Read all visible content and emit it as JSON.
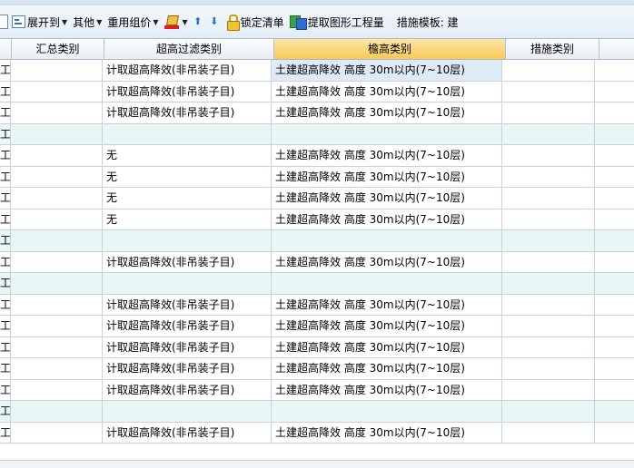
{
  "toolbar": {
    "partial_left_icon": "table-grid-icon",
    "expand_label": "展开到",
    "other_label": "其他",
    "reuse_label": "重用组价",
    "fill_color_icon": "fill-color-icon",
    "move_up_icon": "arrow-up-icon",
    "move_down_icon": "arrow-down-icon",
    "lock_label": "锁定清单",
    "extract_label": "提取图形工程量",
    "measure_template_label": "措施模板: 建"
  },
  "grid": {
    "columns": [
      "",
      "汇总类别",
      "超高过滤类别",
      "檐高类别",
      "措施类别",
      ""
    ],
    "selected_column": "檐高类别",
    "rows": [
      {
        "lead": "工",
        "summary": "",
        "filter": "计取超高降效(非吊装子目)",
        "height": "土建超高降效 高度 30m以内(7~10层)",
        "measure": "",
        "group": false,
        "highlight": true
      },
      {
        "lead": "工",
        "summary": "",
        "filter": "计取超高降效(非吊装子目)",
        "height": "土建超高降效 高度 30m以内(7~10层)",
        "measure": "",
        "group": false,
        "highlight": false
      },
      {
        "lead": "工",
        "summary": "",
        "filter": "计取超高降效(非吊装子目)",
        "height": "土建超高降效 高度 30m以内(7~10层)",
        "measure": "",
        "group": false,
        "highlight": false
      },
      {
        "lead": "工",
        "summary": "",
        "filter": "",
        "height": "",
        "measure": "",
        "group": true,
        "highlight": false
      },
      {
        "lead": "工",
        "summary": "",
        "filter": "无",
        "height": "土建超高降效 高度 30m以内(7~10层)",
        "measure": "",
        "group": false,
        "highlight": false
      },
      {
        "lead": "工",
        "summary": "",
        "filter": "无",
        "height": "土建超高降效 高度 30m以内(7~10层)",
        "measure": "",
        "group": false,
        "highlight": false
      },
      {
        "lead": "工",
        "summary": "",
        "filter": "无",
        "height": "土建超高降效 高度 30m以内(7~10层)",
        "measure": "",
        "group": false,
        "highlight": false
      },
      {
        "lead": "工",
        "summary": "",
        "filter": "无",
        "height": "土建超高降效 高度 30m以内(7~10层)",
        "measure": "",
        "group": false,
        "highlight": false
      },
      {
        "lead": "工",
        "summary": "",
        "filter": "",
        "height": "",
        "measure": "",
        "group": true,
        "highlight": false
      },
      {
        "lead": "工",
        "summary": "",
        "filter": "计取超高降效(非吊装子目)",
        "height": "土建超高降效 高度 30m以内(7~10层)",
        "measure": "",
        "group": false,
        "highlight": false
      },
      {
        "lead": "工",
        "summary": "",
        "filter": "",
        "height": "",
        "measure": "",
        "group": true,
        "highlight": false
      },
      {
        "lead": "工",
        "summary": "",
        "filter": "计取超高降效(非吊装子目)",
        "height": "土建超高降效 高度 30m以内(7~10层)",
        "measure": "",
        "group": false,
        "highlight": false
      },
      {
        "lead": "工",
        "summary": "",
        "filter": "计取超高降效(非吊装子目)",
        "height": "土建超高降效 高度 30m以内(7~10层)",
        "measure": "",
        "group": false,
        "highlight": false
      },
      {
        "lead": "工",
        "summary": "",
        "filter": "计取超高降效(非吊装子目)",
        "height": "土建超高降效 高度 30m以内(7~10层)",
        "measure": "",
        "group": false,
        "highlight": false
      },
      {
        "lead": "工",
        "summary": "",
        "filter": "计取超高降效(非吊装子目)",
        "height": "土建超高降效 高度 30m以内(7~10层)",
        "measure": "",
        "group": false,
        "highlight": false
      },
      {
        "lead": "工",
        "summary": "",
        "filter": "计取超高降效(非吊装子目)",
        "height": "土建超高降效 高度 30m以内(7~10层)",
        "measure": "",
        "group": false,
        "highlight": false
      },
      {
        "lead": "工",
        "summary": "",
        "filter": "",
        "height": "",
        "measure": "",
        "group": true,
        "highlight": false
      },
      {
        "lead": "工",
        "summary": "",
        "filter": "计取超高降效(非吊装子目)",
        "height": "土建超高降效 高度 30m以内(7~10层)",
        "measure": "",
        "group": false,
        "highlight": false
      }
    ]
  }
}
